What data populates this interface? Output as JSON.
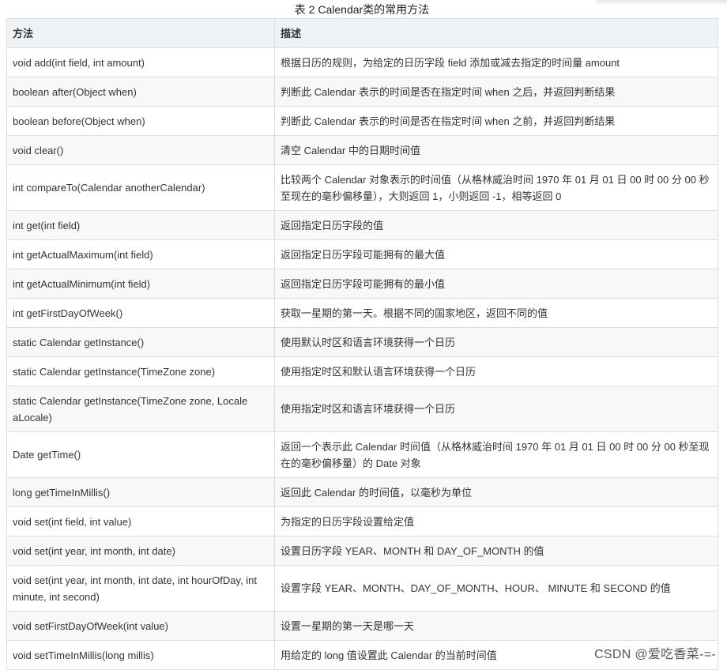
{
  "caption": "表 2 Calendar类的常用方法",
  "table": {
    "headers": [
      "方法",
      "描述"
    ],
    "rows": [
      {
        "method": "void add(int field, int amount)",
        "desc": "根据日历的规则，为给定的日历字段 field 添加或减去指定的时间量 amount"
      },
      {
        "method": "boolean after(Object when)",
        "desc": "判断此 Calendar 表示的时间是否在指定时间 when 之后，并返回判断结果"
      },
      {
        "method": "boolean before(Object when)",
        "desc": "判断此 Calendar 表示的时间是否在指定时间 when 之前，并返回判断结果"
      },
      {
        "method": "void clear()",
        "desc": "清空 Calendar 中的日期时间值"
      },
      {
        "method": "int compareTo(Calendar anotherCalendar)",
        "desc": "比较两个 Calendar 对象表示的时间值（从格林威治时间 1970 年 01 月 01 日 00 时 00 分 00 秒至现在的毫秒偏移量），大则返回 1，小则返回 -1，相等返回 0"
      },
      {
        "method": "int get(int field)",
        "desc": "返回指定日历字段的值"
      },
      {
        "method": "int getActualMaximum(int field)",
        "desc": "返回指定日历字段可能拥有的最大值"
      },
      {
        "method": "int getActualMinimum(int field)",
        "desc": "返回指定日历字段可能拥有的最小值"
      },
      {
        "method": "int getFirstDayOfWeek()",
        "desc": "获取一星期的第一天。根据不同的国家地区，返回不同的值"
      },
      {
        "method": "static Calendar getInstance()",
        "desc": "使用默认时区和语言环境获得一个日历"
      },
      {
        "method": "static Calendar getInstance(TimeZone zone)",
        "desc": "使用指定时区和默认语言环境获得一个日历"
      },
      {
        "method": "static Calendar getInstance(TimeZone zone, Locale aLocale)",
        "desc": "使用指定时区和语言环境获得一个日历"
      },
      {
        "method": "Date getTime()",
        "desc": "返回一个表示此 Calendar 时间值（从格林威治时间 1970 年 01 月 01 日 00 时 00 分 00 秒至现在的毫秒偏移量）的 Date 对象"
      },
      {
        "method": "long getTimeInMillis()",
        "desc": "返回此 Calendar 的时间值，以毫秒为单位"
      },
      {
        "method": "void set(int field, int value)",
        "desc": "为指定的日历字段设置给定值"
      },
      {
        "method": "void set(int year, int month, int date)",
        "desc": "设置日历字段 YEAR、MONTH 和 DAY_OF_MONTH 的值"
      },
      {
        "method": "void set(int year, int month, int date, int hourOfDay, int minute, int second)",
        "desc": "设置字段 YEAR、MONTH、DAY_OF_MONTH、HOUR、 MINUTE 和 SECOND 的值"
      },
      {
        "method": "void setFirstDayOfWeek(int value)",
        "desc": "设置一星期的第一天是哪一天"
      },
      {
        "method": "void setTimeInMillis(long millis)",
        "desc": "用给定的 long 值设置此 Calendar 的当前时间值"
      }
    ]
  },
  "watermark": "CSDN @爱吃香菜-=-"
}
